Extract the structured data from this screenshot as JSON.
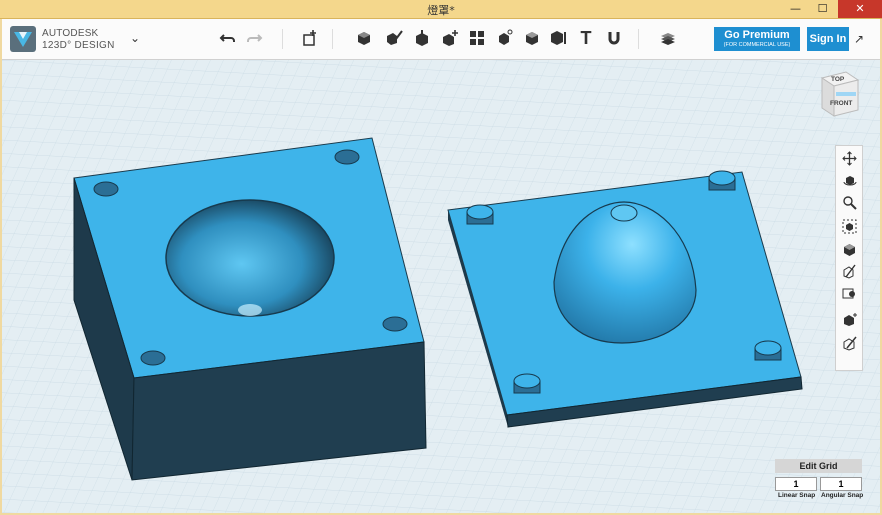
{
  "window": {
    "title": "燈罩*",
    "min": "—",
    "max": "☐",
    "close": "✕"
  },
  "brand": {
    "line1": "AUTODESK",
    "line2": "123D° DESIGN"
  },
  "toolbar": {
    "premium_label": "Go Premium",
    "premium_sub": "(FOR COMMERCIAL USE)",
    "signin_label": "Sign In",
    "text_tool_glyph": "T"
  },
  "viewcube": {
    "top": "TOP",
    "front": "FRONT"
  },
  "grid": {
    "edit_label": "Edit Grid",
    "linear_value": "1",
    "angular_value": "1",
    "linear_label": "Linear Snap",
    "angular_label": "Angular Snap"
  },
  "colors": {
    "model": "#3eb4ea",
    "model_side": "#203e50",
    "accent": "#1e8fd1",
    "grid_bg": "#e4eef3"
  }
}
